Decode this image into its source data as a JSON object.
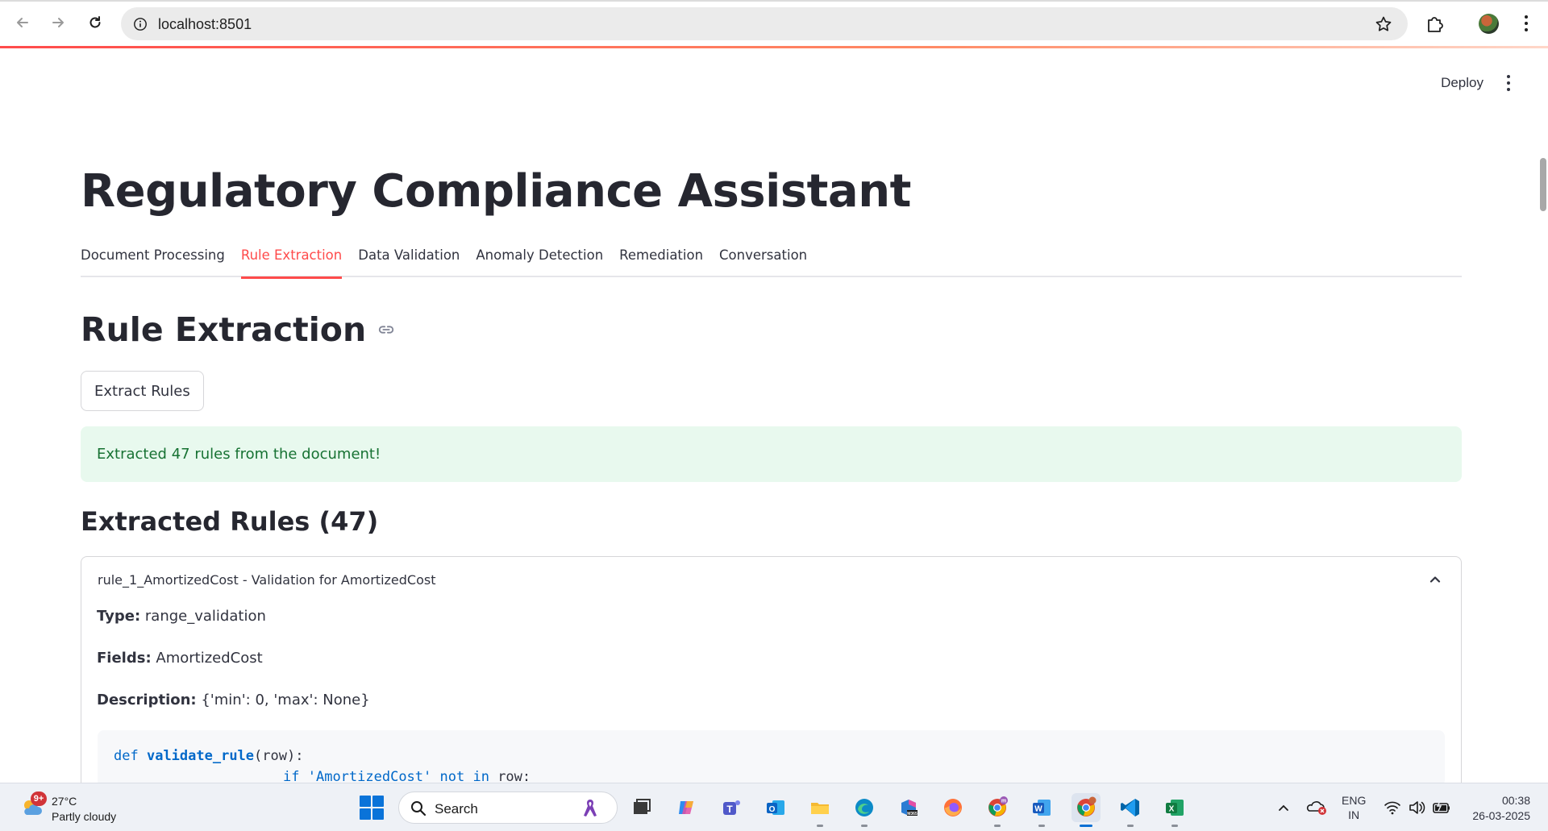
{
  "browser": {
    "url": "localhost:8501"
  },
  "app": {
    "deploy_label": "Deploy",
    "title": "Regulatory Compliance Assistant",
    "tabs": [
      {
        "label": "Document Processing",
        "active": false
      },
      {
        "label": "Rule Extraction",
        "active": true
      },
      {
        "label": "Data Validation",
        "active": false
      },
      {
        "label": "Anomaly Detection",
        "active": false
      },
      {
        "label": "Remediation",
        "active": false
      },
      {
        "label": "Conversation",
        "active": false
      }
    ],
    "section_title": "Rule Extraction",
    "extract_button": "Extract Rules",
    "success_message": "Extracted 47 rules from the document!",
    "rules_header": "Extracted Rules (47)",
    "rule": {
      "header": "rule_1_AmortizedCost - Validation for AmortizedCost",
      "type_label": "Type:",
      "type_value": "range_validation",
      "fields_label": "Fields:",
      "fields_value": "AmortizedCost",
      "description_label": "Description:",
      "description_value": "{'min': 0, 'max': None}",
      "code": {
        "keyword_def": "def",
        "func_name": "validate_rule",
        "params": "(row):",
        "line2_if": "if",
        "line2_string": "'AmortizedCost'",
        "line2_op": "not in",
        "line2_rest": "row:"
      }
    },
    "colors": {
      "accent": "#ff4b4b",
      "success_bg": "#e8f9ee",
      "success_text": "#177233"
    }
  },
  "taskbar": {
    "weather_badge": "9+",
    "weather_temp": "27°C",
    "weather_desc": "Partly cloudy",
    "search_label": "Search",
    "lang_line1": "ENG",
    "lang_line2": "IN",
    "time": "00:38",
    "date": "26-03-2025",
    "apps": [
      "task-view",
      "copilot",
      "teams",
      "outlook",
      "file-explorer",
      "edge",
      "m365",
      "firefox",
      "chrome",
      "word",
      "chrome-active",
      "vscode",
      "excel"
    ]
  }
}
